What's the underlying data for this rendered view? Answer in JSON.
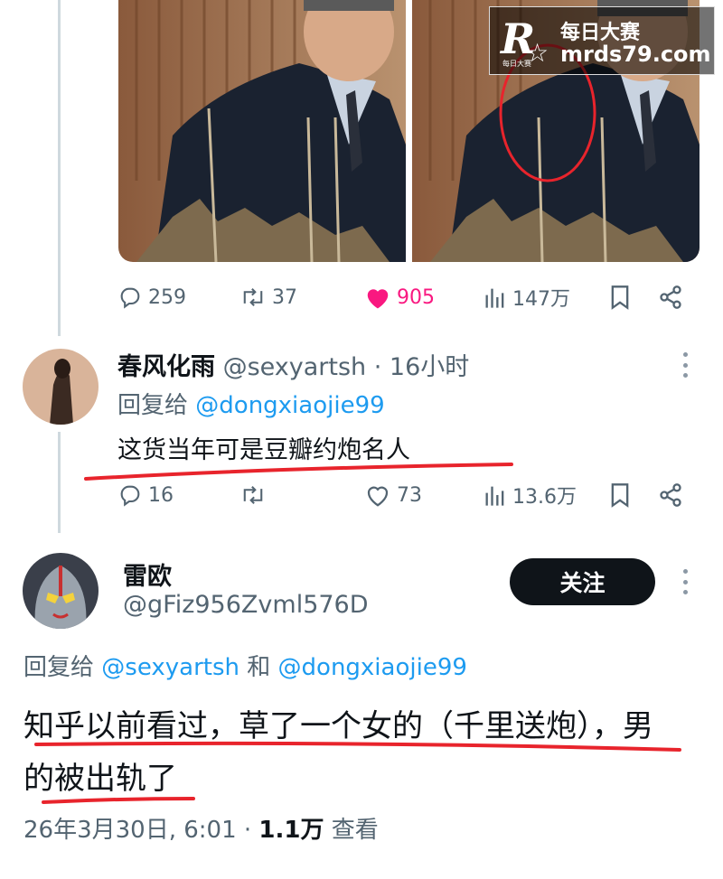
{
  "watermark": {
    "logo_letter": "R",
    "small_text": "每日大赛",
    "title": "每日大赛",
    "url": "mrds79.com"
  },
  "tweet_top": {
    "stats": {
      "replies": "259",
      "retweets": "37",
      "likes": "905",
      "views": "147万"
    },
    "like_color": "#f91880"
  },
  "reply1": {
    "name": "春风化雨",
    "handle": "@sexyartsh",
    "time": "· 16小时",
    "reply_prefix": "回复给",
    "reply_mention": "@dongxiaojie99",
    "text": "这货当年可是豆瓣约炮名人",
    "stats": {
      "replies": "16",
      "retweets": "",
      "likes": "73",
      "views": "13.6万"
    }
  },
  "reply2": {
    "name": "雷欧",
    "handle": "@gFiz956Zvml576D",
    "follow_label": "关注",
    "reply_prefix": "回复给",
    "reply_mention1": "@sexyartsh",
    "reply_and": "和",
    "reply_mention2": "@dongxiaojie99",
    "text_line1": "知乎以前看过，草了一个女的（千里送炮），男",
    "text_line2": "的被出轨了",
    "date": "26年3月30日, 6:01 · ",
    "views_count": "1.1万",
    "views_label": " 查看"
  },
  "colors": {
    "accent": "#1d9bf0",
    "muted": "#536471",
    "annotation": "#e8242c"
  },
  "icons": [
    "reply-icon",
    "retweet-icon",
    "heart-icon",
    "views-icon",
    "bookmark-icon",
    "share-icon",
    "more-icon"
  ]
}
